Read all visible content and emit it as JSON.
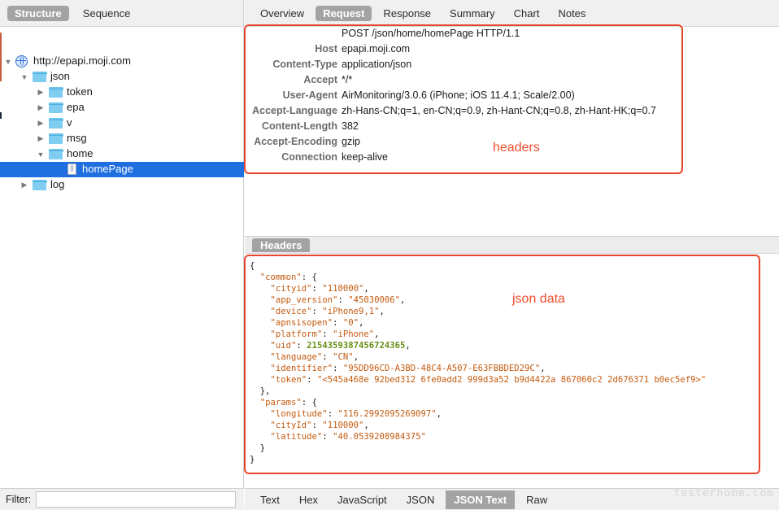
{
  "left_pane": {
    "segments": [
      "Structure",
      "Sequence"
    ],
    "active_segment": "Structure",
    "tree": [
      {
        "label": "http://epapi.moji.com",
        "icon": "globe-icon",
        "expanded": true,
        "depth": 0
      },
      {
        "label": "json",
        "icon": "folder-icon",
        "expanded": true,
        "depth": 1
      },
      {
        "label": "token",
        "icon": "folder-icon",
        "expanded": false,
        "depth": 2
      },
      {
        "label": "epa",
        "icon": "folder-icon",
        "expanded": false,
        "depth": 2
      },
      {
        "label": "v",
        "icon": "folder-icon",
        "expanded": false,
        "depth": 2
      },
      {
        "label": "msg",
        "icon": "folder-icon",
        "expanded": false,
        "depth": 2
      },
      {
        "label": "home",
        "icon": "folder-icon",
        "expanded": true,
        "depth": 2
      },
      {
        "label": "homePage",
        "icon": "json-file-icon",
        "selected": true,
        "depth": 3
      },
      {
        "label": "log",
        "icon": "folder-icon",
        "expanded": false,
        "depth": 1
      }
    ],
    "filter": {
      "label": "Filter:",
      "value": ""
    }
  },
  "right_pane": {
    "tabs": [
      "Overview",
      "Request",
      "Response",
      "Summary",
      "Chart",
      "Notes"
    ],
    "active_tab": "Request",
    "request_line": "POST /json/home/homePage HTTP/1.1",
    "headers": [
      {
        "name": "Host",
        "value": "epapi.moji.com"
      },
      {
        "name": "Content-Type",
        "value": "application/json"
      },
      {
        "name": "Accept",
        "value": "*/*"
      },
      {
        "name": "User-Agent",
        "value": "AirMonitoring/3.0.6 (iPhone; iOS 11.4.1; Scale/2.00)"
      },
      {
        "name": "Accept-Language",
        "value": "zh-Hans-CN;q=1, en-CN;q=0.9, zh-Hant-CN;q=0.8, zh-Hant-HK;q=0.7"
      },
      {
        "name": "Content-Length",
        "value": "382"
      },
      {
        "name": "Accept-Encoding",
        "value": "gzip"
      },
      {
        "name": "Connection",
        "value": "keep-alive"
      }
    ],
    "splitter_tab": "Headers",
    "bottom_tabs": [
      "Text",
      "Hex",
      "JavaScript",
      "JSON",
      "JSON Text",
      "Raw"
    ],
    "active_bottom_tab": "JSON Text"
  },
  "json_text": {
    "open_brace": "{",
    "close_brace": "}",
    "common_key": "common",
    "params_key": "params",
    "common": [
      {
        "key": "cityid",
        "value": "110000",
        "kind": "string"
      },
      {
        "key": "app_version",
        "value": "45030006",
        "kind": "string"
      },
      {
        "key": "device",
        "value": "iPhone9,1",
        "kind": "string"
      },
      {
        "key": "apnsisopen",
        "value": "0",
        "kind": "string"
      },
      {
        "key": "platform",
        "value": "iPhone",
        "kind": "string"
      },
      {
        "key": "uid",
        "value": "2154359387456724365",
        "kind": "number"
      },
      {
        "key": "language",
        "value": "CN",
        "kind": "string"
      },
      {
        "key": "identifier",
        "value": "95DD96CD-A3BD-48C4-A507-E63FBBDED29C",
        "kind": "string"
      },
      {
        "key": "token",
        "value": "<545a468e 92bed312 6fe0add2 999d3a52 b9d4422a 867060c2 2d676371 b0ec5ef9>",
        "kind": "string"
      }
    ],
    "params": [
      {
        "key": "longitude",
        "value": "116.2992095269097",
        "kind": "string"
      },
      {
        "key": "cityId",
        "value": "110000",
        "kind": "string"
      },
      {
        "key": "latitude",
        "value": "40.0539208984375",
        "kind": "string"
      }
    ]
  },
  "annotations": {
    "headers_label": "headers",
    "json_label": "json data",
    "color": "#e8462c"
  },
  "watermark": "testerhome.com",
  "colors": {
    "selection": "#1f6fe0",
    "active_tab": "#a3a3a3",
    "json_key": "#c45a0f",
    "json_number": "#6a8f18"
  }
}
